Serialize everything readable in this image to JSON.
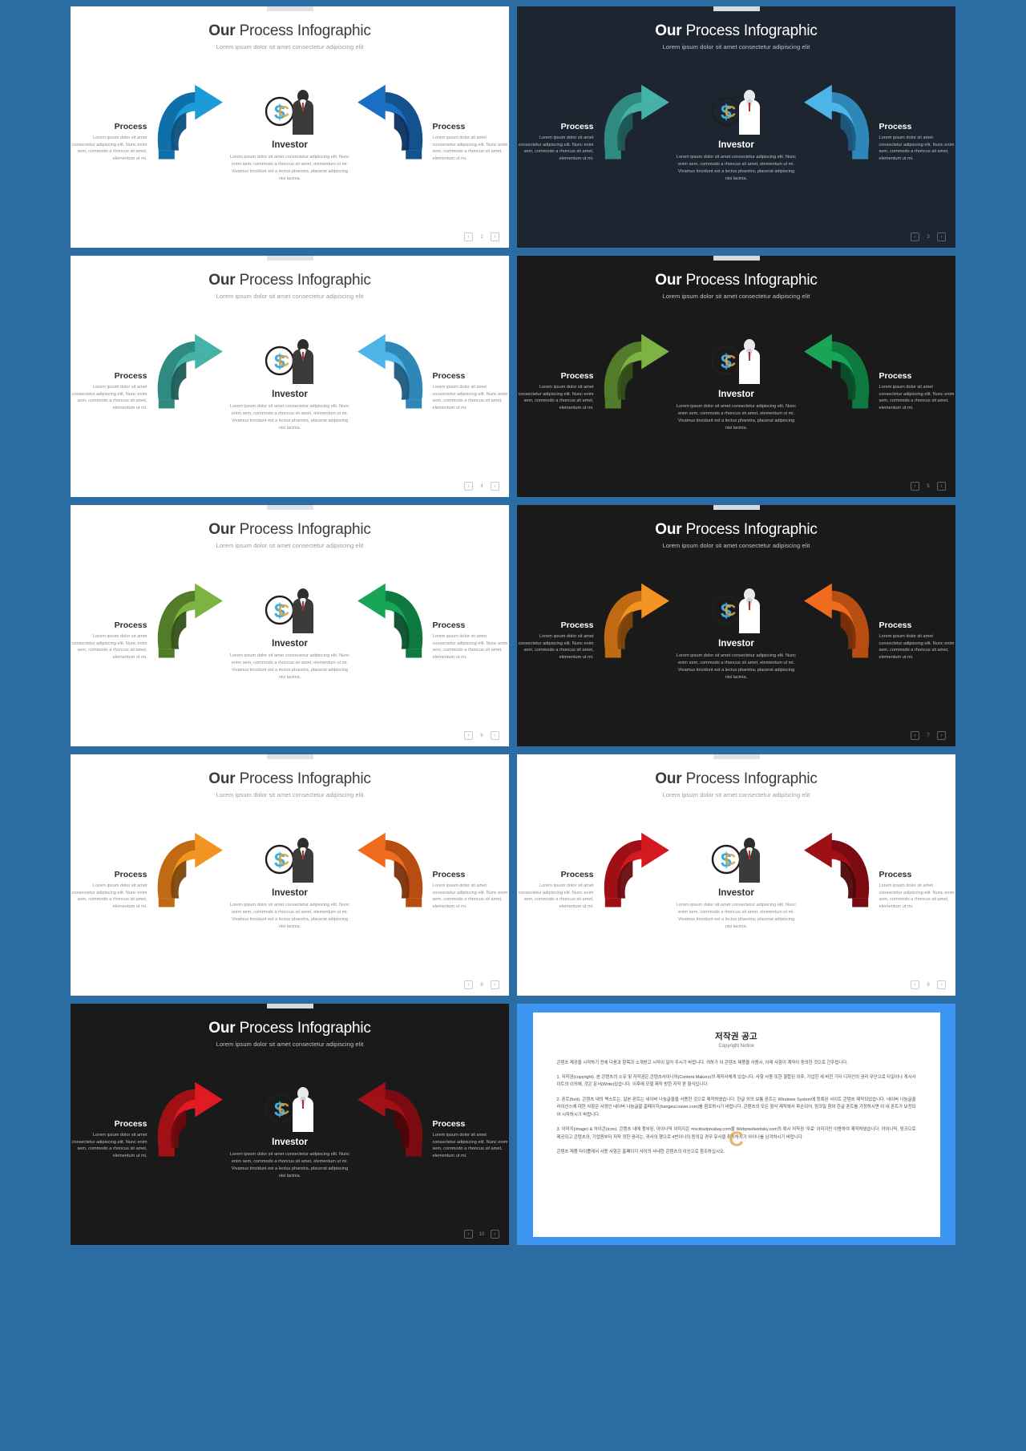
{
  "deck": {
    "title_bold": "Our",
    "title_rest": " Process Infographic",
    "subtitle": "Lorem ipsum dolor sit amet consectetur adipiscing elit"
  },
  "labels": {
    "process": "Process",
    "investor": "Investor",
    "side_body": "Lorem ipsum dolor sit amet consectetur adipiscing elit. Nunc enim sem, commodo a rhoncus sit amet, elementum ut mi.",
    "center_body": "Lorem ipsum dolor sit amet consectetur adipiscing elit. Nunc enim sem, commodo a rhoncus sit amet, elementum ut mi. Vivamus tincidunt est a lectus pharetra, placerat adipiscing nisi lacinia.",
    "prev_icon": "‹",
    "next_icon": "›"
  },
  "slides": [
    {
      "theme": "light",
      "page": "2",
      "left_color": "#1d9bd9",
      "left_dark": "#0f6fa8",
      "left_shadow": "#0b4f7d",
      "right_color": "#1a6fc4",
      "right_dark": "#14528f",
      "right_shadow": "#0c2f5e",
      "icon_tone": "dark"
    },
    {
      "theme": "dark-navy",
      "page": "3",
      "left_color": "#45b2a8",
      "left_dark": "#2f8a82",
      "left_shadow": "#1d5b56",
      "right_color": "#4db5e8",
      "right_dark": "#2f87b8",
      "right_shadow": "#1c5a80",
      "icon_tone": "light"
    },
    {
      "theme": "light",
      "page": "4",
      "left_color": "#45b2a8",
      "left_dark": "#2f8a82",
      "left_shadow": "#1d5b56",
      "right_color": "#4db5e8",
      "right_dark": "#2f87b8",
      "right_shadow": "#1c5a80",
      "icon_tone": "dark"
    },
    {
      "theme": "dark",
      "page": "5",
      "left_color": "#7cb342",
      "left_dark": "#527c2a",
      "left_shadow": "#33511a",
      "right_color": "#18a558",
      "right_dark": "#0f7a3f",
      "right_shadow": "#0a4f29",
      "icon_tone": "light"
    },
    {
      "theme": "light",
      "page": "6",
      "left_color": "#7cb342",
      "left_dark": "#527c2a",
      "left_shadow": "#33511a",
      "right_color": "#18a558",
      "right_dark": "#0f7a3f",
      "right_shadow": "#0a4f29",
      "icon_tone": "dark"
    },
    {
      "theme": "dark",
      "page": "7",
      "left_color": "#f39422",
      "left_dark": "#c06a14",
      "left_shadow": "#80450c",
      "right_color": "#ef6c1f",
      "right_dark": "#b84d12",
      "right_shadow": "#7a320b",
      "icon_tone": "light"
    },
    {
      "theme": "light",
      "page": "8",
      "left_color": "#f39422",
      "left_dark": "#c06a14",
      "left_shadow": "#80450c",
      "right_color": "#ef6c1f",
      "right_dark": "#b84d12",
      "right_shadow": "#7a320b",
      "icon_tone": "dark"
    },
    {
      "theme": "light",
      "page": "9",
      "left_color": "#d41a20",
      "left_dark": "#9e1015",
      "left_shadow": "#6b0a0e",
      "right_color": "#9e1015",
      "right_dark": "#7a0b10",
      "right_shadow": "#4d060a",
      "icon_tone": "dark"
    },
    {
      "theme": "dark",
      "page": "10",
      "left_color": "#e01b22",
      "left_dark": "#a01015",
      "left_shadow": "#6b0a0e",
      "right_color": "#a01015",
      "right_dark": "#7a0b10",
      "right_shadow": "#4d060a",
      "icon_tone": "light"
    }
  ],
  "copyright": {
    "title": "저작권 공고",
    "title_en": "Copyright Notice",
    "paragraphs": [
      "콘텐츠 제공을 시작하기 전에 다음과 항목과 소개받고 시작이 일어 주시기 바랍니다. 귀하가 이 콘텐츠 제품을 사용시, 아래 사항이 계약이 동의한 것으로 간주됩니다.",
      "1. 저작권(copyright). 본 콘텐츠의 소유 및 저작권은 콘텐츠사이니어(Content Makers)의 제작사에게 있습니다. 사항 사용 또한 결합된 이후, 기업한 세 버전 기타 디자인의 권리 무단으로 타일이나 게시사이트의 이외에, 것은 문서(Write)있습니다. 이후에 모델 제작 방한 저작 판 형식입니다.",
      "2. 폰트(font). 콘텐츠 내의 텍스트는, 일본 폰트는 네이버 나눔글꼴을 사용한 것으로 제작하였습니다. 한글 외의 보통 폰트는 Windows System에 등록된 사이트 콘텐츠 제작되었습니다. 네이버 나눔글꼴 라이선스에 대한 사항은 사정인 네이버 나눔글꼴 홈페이지(hangeul.naver.com)를 참조하시기 바랍니다. 콘텐츠의 모든 형식 제작에서 파손되어, 링크일 참여 한글 폰트를 가정하시면 이 내 폰트가 보전되어 시작하시기 바랍니다.",
      "3. 이미지(image) & 아이콘(icon). 콘텐츠 내에 첨부된, 아이나믹 이미지은 =iscitoutpixabay.com을 Webpixelwebsky.com의 뤼시 저작권 '무료' 이미지만 이용하여 제작하였습니다. 아이나믹, 링크으로 제공되고 콘텐츠의, 기업원부터 저작 정한 권리는, 귀사의 행으로 4번이나의 등의길 경우 유사을 취득하시기 아이나를 남겨하시기 바랍니다.",
      "콘텐츠 제품 타이틀에서 사용 사항은 홈페이지 사이의 사내한 콘텐츠의 이신으로 참조하십시오."
    ],
    "watermark": "C"
  }
}
